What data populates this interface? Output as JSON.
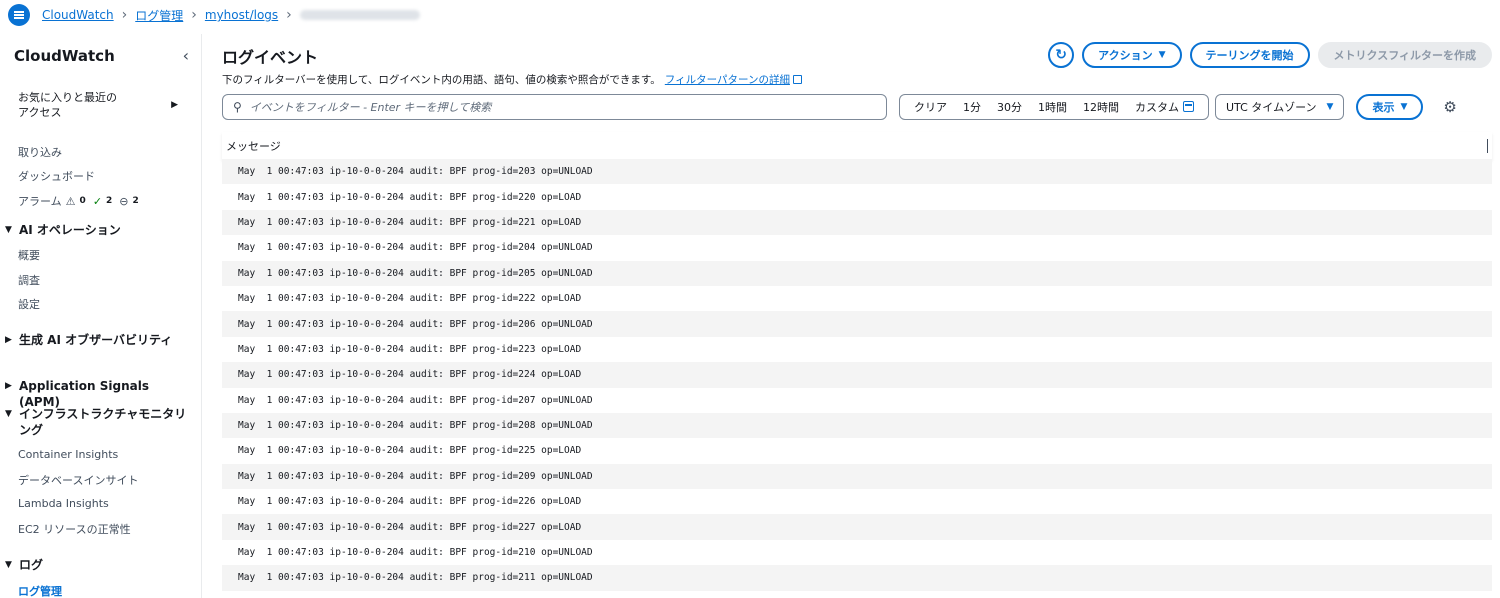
{
  "breadcrumb": {
    "items": [
      "CloudWatch",
      "ログ管理",
      "myhost/logs"
    ]
  },
  "sidebar": {
    "title": "CloudWatch",
    "favorites": "お気に入りと最近の\nアクセス",
    "items": {
      "ingest": "取り込み",
      "dashboard": "ダッシュボード",
      "alarm": "アラーム",
      "alarm_counts": [
        "0",
        "2",
        "2"
      ],
      "ai_ops": "AI オペレーション",
      "overview": "概要",
      "investigate": "調査",
      "settings": "設定",
      "genai": "生成 AI オブザーバビリティ",
      "app_signals": "Application Signals (APM)",
      "infra": "インフラストラクチャモニタリング",
      "container": "Container Insights",
      "db": "データベースインサイト",
      "lambda": "Lambda Insights",
      "ec2": "EC2 リソースの正常性",
      "logs": "ログ",
      "log_mgmt": "ログ管理"
    }
  },
  "main": {
    "title": "ログイベント",
    "description": "下のフィルターバーを使用して、ログイベント内の用語、語句、値の検索や照合ができます。",
    "description_link": "フィルターパターンの詳細",
    "buttons": {
      "actions": "アクション",
      "tailing": "テーリングを開始",
      "metric_filter": "メトリクスフィルターを作成",
      "display": "表示"
    },
    "search": {
      "placeholder": "イベントをフィルター - Enter キーを押して検索",
      "value": ""
    },
    "range": {
      "clear": "クリア",
      "m1": "1分",
      "m30": "30分",
      "h1": "1時間",
      "h12": "12時間",
      "custom": "カスタム"
    },
    "timezone": "UTC タイムゾーン",
    "column_header": "メッセージ",
    "rows": [
      "May  1 00:47:03 ip-10-0-0-204 audit: BPF prog-id=203 op=UNLOAD",
      "May  1 00:47:03 ip-10-0-0-204 audit: BPF prog-id=220 op=LOAD",
      "May  1 00:47:03 ip-10-0-0-204 audit: BPF prog-id=221 op=LOAD",
      "May  1 00:47:03 ip-10-0-0-204 audit: BPF prog-id=204 op=UNLOAD",
      "May  1 00:47:03 ip-10-0-0-204 audit: BPF prog-id=205 op=UNLOAD",
      "May  1 00:47:03 ip-10-0-0-204 audit: BPF prog-id=222 op=LOAD",
      "May  1 00:47:03 ip-10-0-0-204 audit: BPF prog-id=206 op=UNLOAD",
      "May  1 00:47:03 ip-10-0-0-204 audit: BPF prog-id=223 op=LOAD",
      "May  1 00:47:03 ip-10-0-0-204 audit: BPF prog-id=224 op=LOAD",
      "May  1 00:47:03 ip-10-0-0-204 audit: BPF prog-id=207 op=UNLOAD",
      "May  1 00:47:03 ip-10-0-0-204 audit: BPF prog-id=208 op=UNLOAD",
      "May  1 00:47:03 ip-10-0-0-204 audit: BPF prog-id=225 op=LOAD",
      "May  1 00:47:03 ip-10-0-0-204 audit: BPF prog-id=209 op=UNLOAD",
      "May  1 00:47:03 ip-10-0-0-204 audit: BPF prog-id=226 op=LOAD",
      "May  1 00:47:03 ip-10-0-0-204 audit: BPF prog-id=227 op=LOAD",
      "May  1 00:47:03 ip-10-0-0-204 audit: BPF prog-id=210 op=UNLOAD",
      "May  1 00:47:03 ip-10-0-0-204 audit: BPF prog-id=211 op=UNLOAD"
    ]
  },
  "icons": {
    "menu": "menu-icon",
    "refresh": "refresh-icon",
    "search": "search-icon",
    "calendar": "calendar-icon",
    "gear": "gear-icon",
    "external": "external-link-icon"
  },
  "colors": {
    "accent": "#0972d3",
    "ok": "#037f0c",
    "text": "#16191f",
    "row_alt": "#f4f4f4"
  }
}
